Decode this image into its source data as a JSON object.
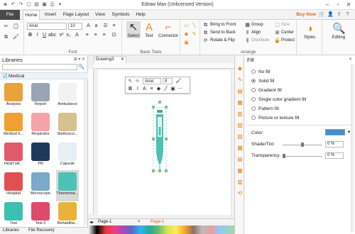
{
  "window": {
    "title": "Edraw Max (Unlicensed Version)"
  },
  "menu": {
    "file": "File",
    "items": [
      "Home",
      "Insert",
      "Page Layout",
      "View",
      "Symbols",
      "Help"
    ],
    "buy_now": "Buy Now"
  },
  "ribbon": {
    "font": {
      "family": "Arial",
      "size": "10",
      "label": "Font"
    },
    "basic_tools": {
      "select": "Select",
      "text": "Text",
      "connector": "Connector",
      "label": "Basic Tools"
    },
    "arrange": {
      "bring_to_front": "Bring to Front",
      "send_to_back": "Send to Back",
      "rotate_flip": "Rotate & Flip",
      "group": "Group",
      "align": "Align",
      "distribute": "Distribute",
      "size": "Size",
      "center": "Center",
      "protect": "Protect",
      "label": "Arrange"
    },
    "styles": "Styles",
    "editing": "Editing"
  },
  "libraries": {
    "title": "Libraries",
    "category": "Medical",
    "items": [
      {
        "label": "Analysis",
        "color": "#e8a33a"
      },
      {
        "label": "Report",
        "color": "#9aa4b5"
      },
      {
        "label": "Ambulance",
        "color": "#f2f2f2"
      },
      {
        "label": "Medical b...",
        "color": "#f0a030"
      },
      {
        "label": "Respirator",
        "color": "#f4a3a8"
      },
      {
        "label": "Stethosco...",
        "color": "#d8c090"
      },
      {
        "label": "Heart wit...",
        "color": "#e05a6a"
      },
      {
        "label": "Pill",
        "color": "#1e3a5a"
      },
      {
        "label": "Capsule",
        "color": "#e9eef3"
      },
      {
        "label": "Hospital",
        "color": "#e05050"
      },
      {
        "label": "Microscope",
        "color": "#7aa9c9"
      },
      {
        "label": "Thermome...",
        "color": "#4dc1b5"
      },
      {
        "label": "Test",
        "color": "#3bbfb0"
      },
      {
        "label": "Test 2",
        "color": "#e04a6a"
      },
      {
        "label": "Rehabilita...",
        "color": "#e7b33b"
      }
    ],
    "tabs": [
      "Libraries",
      "File Recovery"
    ]
  },
  "document": {
    "tab": "Drawing3",
    "page_tab": "Page-1",
    "active_page": "Page-1"
  },
  "floating_toolbar": {
    "font": "Arial",
    "size": "8"
  },
  "fill_panel": {
    "title": "Fill",
    "options": [
      "No fill",
      "Solid fill",
      "Gradient fill",
      "Single color gradient fill",
      "Pattern fill",
      "Picture or texture fill"
    ],
    "selected": "Solid fill",
    "color_label": "Color:",
    "color_value": "#3d8fd6",
    "shade_label": "Shade/Tint:",
    "shade_value": "0 %",
    "transparency_label": "Transparency:",
    "transparency_value": "0 %"
  },
  "colors": {
    "accent": "#2f6fbf",
    "file_tab": "#4a4a4a",
    "thermometer": "#4dc1b5",
    "buy_now": "#d2691e"
  }
}
